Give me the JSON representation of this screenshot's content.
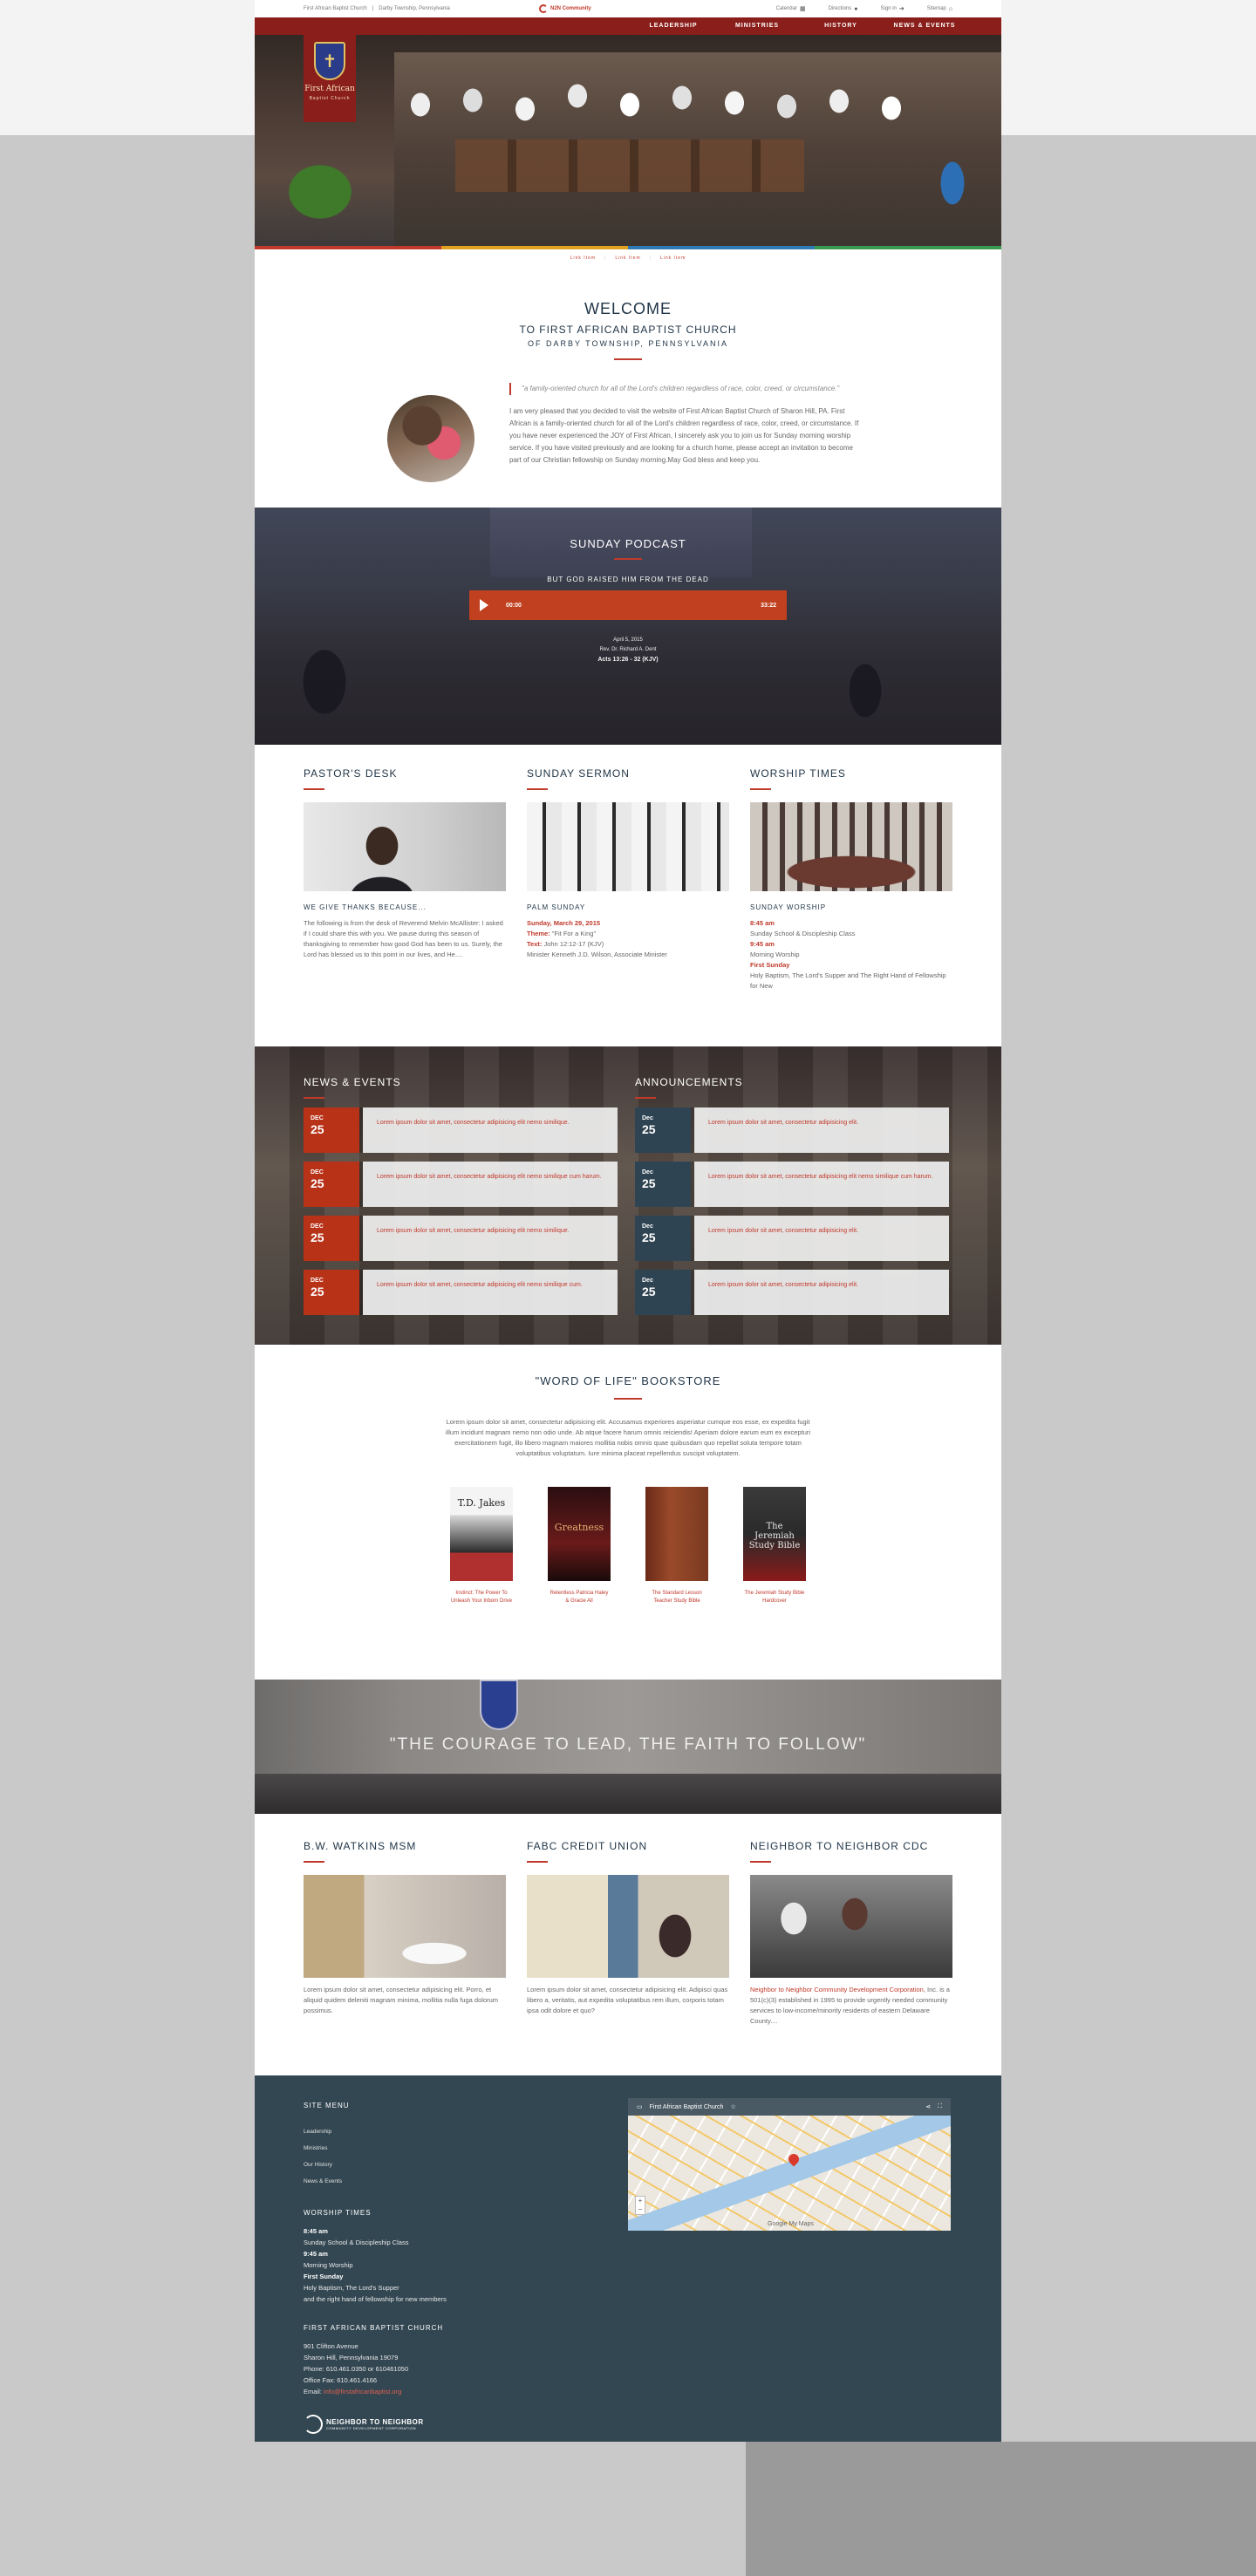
{
  "colors": {
    "brand_red": "#8a1e1a",
    "accent": "#c0392b",
    "navy": "#1f3446",
    "footer": "#334752"
  },
  "topbar": {
    "church": "First African Baptist Church",
    "location": "Darby Township, Pennsylvania",
    "partner_logo": "N2N Community",
    "calendar": "Calendar",
    "directions": "Directions",
    "signin": "Sign in",
    "sitemap": "Sitemap"
  },
  "nav": {
    "items": [
      "Leadership",
      "Ministries",
      "History",
      "News & Events"
    ]
  },
  "crest": {
    "name": "First African",
    "sub": "Baptist Church"
  },
  "subnav": [
    "Link Item",
    "Link Item",
    "Link Item"
  ],
  "welcome": {
    "title": "WELCOME",
    "subtitle": "TO FIRST AFRICAN BAPTIST CHURCH",
    "location": "OF DARBY TOWNSHIP, PENNSYLVANIA",
    "quote": "\"a family-oriented church for all of the Lord's children regardless of race, color, creed, or circumstance.\"",
    "body": "I am very pleased that you decided to visit the website of First African Baptist Church of Sharon Hill, PA. First African is a family-oriented church for all of the Lord's children regardless of race, color, creed, or circumstance. If you have never experienced the JOY of First African, I sincerely ask you to join us for Sunday morning worship service. If you have visited previously and are looking for a church home, please accept an invitation to become part of our Christian fellowship on Sunday morning.May God bless and keep you."
  },
  "podcast": {
    "heading": "SUNDAY PODCAST",
    "episode": "BUT GOD RAISED HIM FROM THE DEAD",
    "time_current": "00:00",
    "time_total": "33:22",
    "date": "April 5, 2015",
    "speaker": "Rev. Dr. Richard A. Dent",
    "scripture": "Acts 13:26 - 32 (KJV)"
  },
  "pastor": {
    "heading": "PASTOR'S DESK",
    "subheading": "WE GIVE THANKS BECAUSE...",
    "text": "The following is from the desk of Reverend Melvin McAllister: I asked if I could share this with you. We pause during this season of thanksgiving to remember how good God has been to us. Surely, the Lord has blessed us to this point in our lives, and He...."
  },
  "sermon": {
    "heading": "SUNDAY SERMON",
    "subheading": "PALM SUNDAY",
    "date": "Sunday, March 29, 2015",
    "theme_label": "Theme:",
    "theme": "\"Fit For a King\"",
    "text_label": "Text:",
    "text": "John 12:12-17 (KJV)",
    "minister": "Minister Kenneth J.D. Wilson, Associate Minister"
  },
  "worship": {
    "heading": "WORSHIP TIMES",
    "subheading": "SUNDAY WORSHIP",
    "t1": "8:45 am",
    "d1": "Sunday School & Discipleship Class",
    "t2": "9:45 am",
    "d2": "Morning Worship",
    "t3": "First Sunday",
    "d3": "Holy Baptism, The Lord's Supper and The Right Hand of Fellowship for New"
  },
  "news": {
    "heading": "NEWS & EVENTS",
    "items": [
      {
        "month": "DEC",
        "day": "25",
        "text": "Lorem ipsum dolor sit amet, consectetur adipisicing elit nemo similique."
      },
      {
        "month": "DEC",
        "day": "25",
        "text": "Lorem ipsum dolor sit amet, consectetur adipisicing elit nemo similique cum harum."
      },
      {
        "month": "DEC",
        "day": "25",
        "text": "Lorem ipsum dolor sit amet, consectetur adipisicing elit nemo similique."
      },
      {
        "month": "DEC",
        "day": "25",
        "text": "Lorem ipsum dolor sit amet, consectetur adipisicing elit nemo similique cum."
      }
    ]
  },
  "announcements": {
    "heading": "ANNOUNCEMENTS",
    "items": [
      {
        "month": "Dec",
        "day": "25",
        "text": "Lorem ipsum dolor sit amet, consectetur adipisicing elit."
      },
      {
        "month": "Dec",
        "day": "25",
        "text": "Lorem ipsum dolor sit amet, consectetur adipisicing elit nemo similique cum harum."
      },
      {
        "month": "Dec",
        "day": "25",
        "text": "Lorem ipsum dolor sit amet, consectetur adipisicing elit."
      },
      {
        "month": "Dec",
        "day": "25",
        "text": "Lorem ipsum dolor sit amet, consectetur adipisicing elit."
      }
    ]
  },
  "bookstore": {
    "heading": "\"WORD OF LIFE\" BOOKSTORE",
    "text": "Lorem ipsum dolor sit amet, consectetur adipisicing elit. Accusamus experiores asperiatur cumque eos esse, ex expedita fugit illum incidunt magnam nemo non odio unde. Ab atque facere harum omnis reiciendis! Aperiam dolore earum eum ex excepturi exercitationem fugit, illo libero magnam maiores mollitia nobis omnis quae quibusdam quo repellat soluta tempore totam voluptatibus voluptatum. Iure minima placeat repellendus suscipit voluptatem.",
    "books": [
      {
        "cover": "T.D. Jakes",
        "caption": "Instinct: The Power To Unleash Your Inborn Drive"
      },
      {
        "cover": "Greatness",
        "caption": "Relentless\nPatricia Haley & Gracie All"
      },
      {
        "cover": "",
        "caption": "The Standard Lesson Teacher Study Bible"
      },
      {
        "cover": "The Jeremiah Study Bible",
        "caption": "The Jeremiah Study Bible Hardcover"
      }
    ]
  },
  "band": {
    "quote": "\"THE COURAGE TO LEAD, THE FAITH TO FOLLOW\""
  },
  "partners": [
    {
      "heading": "B.W. WATKINS MSM",
      "text": "Lorem ipsum dolor sit amet, consectetur adipisicing elit. Porro, et aliquid quidem deleniti magnam minima, mollitia nulla fuga dolorum possimus.",
      "link": ""
    },
    {
      "heading": "FABC CREDIT UNION",
      "text": "Lorem ipsum dolor sit amet, consectetur adipisicing elit. Adipisci quas libero a, veritatis, aut expedita voluptatibus rem illum, corporis totam ipsa odit dolore et quo?",
      "link": ""
    },
    {
      "heading": "NEIGHBOR TO NEIGHBOR CDC",
      "text": "Inc. is a 501(c)(3) established in 1995 to provide urgently needed community services to low-income/minority residents of eastern Delaware County....",
      "link": "Neighbor to Neighbor Community Development Corporation,"
    }
  ],
  "footer": {
    "menu_heading": "SITE MENU",
    "menu": [
      "Leadership",
      "Ministries",
      "Our History",
      "News & Events"
    ],
    "worship_heading": "WORSHIP TIMES",
    "worship": [
      {
        "b": "8:45 am",
        "t": "Sunday School & Discipleship Class"
      },
      {
        "b": "9:45 am",
        "t": "Morning Worship"
      },
      {
        "b": "First Sunday",
        "t": "Holy Baptism, The Lord's Supper"
      }
    ],
    "worship_last": "and the right hand of fellowship for new members",
    "church_heading": "FIRST AFRICAN BAPTIST CHURCH",
    "address1": "901 Clifton Avenue",
    "address2": "Sharon Hill, Pennsylvania 19079",
    "phone": "Phone: 610.461.0350 or 610461050",
    "fax": "Office Fax: 610.461.4166",
    "email_label": "Email:",
    "email": "info@firstafricanbaptist.org",
    "n2n_title": "NEIGHBOR TO NEIGHBOR",
    "n2n_sub": "COMMUNITY DEVELOPMENT CORPORATION"
  },
  "map": {
    "title": "First African Baptist Church",
    "attribution": "Google My Maps"
  }
}
